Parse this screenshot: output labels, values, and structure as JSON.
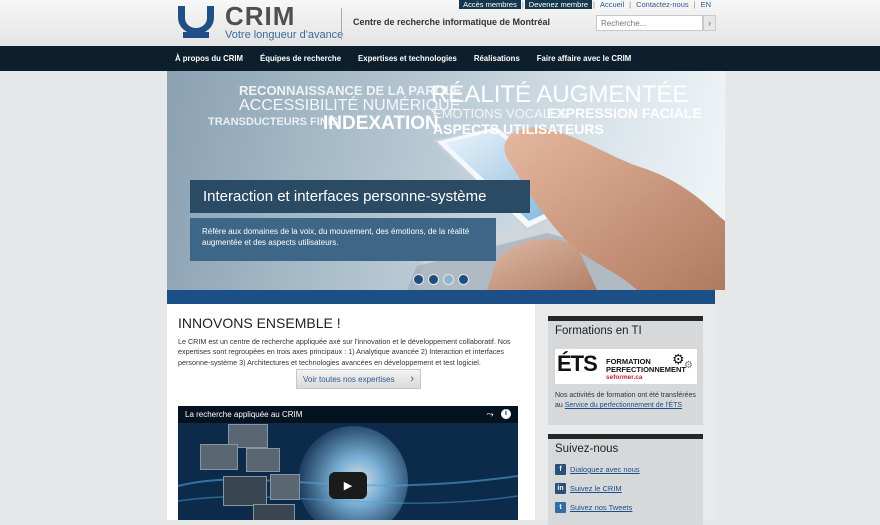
{
  "header": {
    "logo_name": "CRIM",
    "logo_tagline": "Votre longueur d'avance",
    "org_name": "Centre de recherche informatique de Montréal",
    "top_links": [
      "Accès membres",
      "Devenez membre",
      "Accueil",
      "Contactez-nous",
      "EN"
    ],
    "search_placeholder": "Recherche..."
  },
  "nav": {
    "items": [
      "À propos du CRIM",
      "Équipes de recherche",
      "Expertises et technologies",
      "Réalisations",
      "Faire affaire avec le CRIM"
    ]
  },
  "hero": {
    "keywords": [
      "RECONNAISSANCE DE LA PAROLE",
      "ACCESSIBILITÉ NUMÉRIQUE",
      "TRANSDUCTEURS FINIS",
      "INDEXATION",
      "RÉALITÉ AUGMENTÉE",
      "ÉMOTIONS VOCALES",
      "EXPRESSION FACIALE",
      "ASPECTS UTILISATEURS"
    ],
    "caption_title": "Interaction et interfaces personne-système",
    "caption_body": "Réfère aux domaines de la voix, du mouvement, des émotions, de la réalité augmentée et des aspects utilisateurs.",
    "slide_count": 4,
    "active_slide": 3
  },
  "main": {
    "title": "INNOVONS ENSEMBLE !",
    "intro": "Le CRIM est un centre de recherche appliquée axé sur l'innovation et le développement collaboratif. Nos expertises sont regroupées en trois axes principaux : 1) Analytique avancée 2) Interaction et interfaces personne-système 3) Architectures et technologies avancées en développement et test logiciel.",
    "button_label": "Voir toutes nos expertises",
    "video_title": "La recherche appliquée au CRIM"
  },
  "sidebar": {
    "formations_title": "Formations en TI",
    "ets_logo": "ÉTS",
    "ets_line1": "FORMATION",
    "ets_line2": "PERFECTIONNEMENT",
    "ets_line3": "seformer.ca",
    "formations_text": "Nos activités de formation ont été transférées au",
    "formations_link": "Service du perfectionnement de l'ÉTS",
    "social_title": "Suivez-nous",
    "social_links": [
      {
        "icon": "facebook-icon",
        "label": "Dialoguez avec nous"
      },
      {
        "icon": "linkedin-icon",
        "label": "Suivez le CRIM"
      },
      {
        "icon": "twitter-icon",
        "label": "Suivez nos Tweets"
      }
    ]
  },
  "colors": {
    "nav_bg": "#0d1e2c",
    "accent_blue": "#1c4f86",
    "caption_dark": "#2b4a63",
    "caption_light": "#3e6686"
  }
}
